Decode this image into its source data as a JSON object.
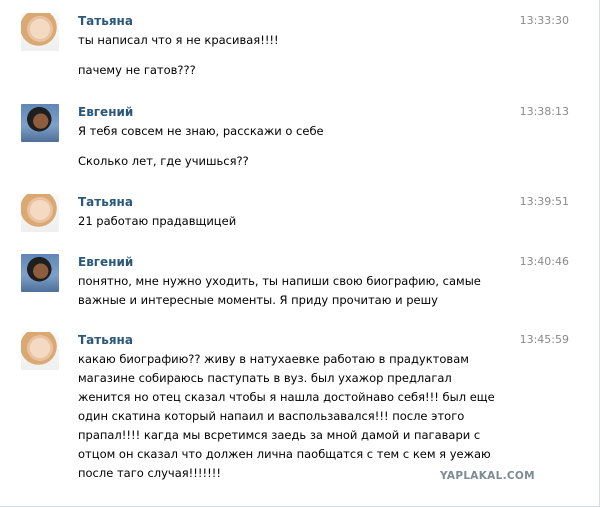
{
  "messages": [
    {
      "author": "Татьяна",
      "time": "13:33:30",
      "lines": [
        "ты написал что я не красивая!!!!"
      ],
      "lines2": [
        "пачему не гатов???"
      ]
    },
    {
      "author": "Евгений",
      "time": "13:38:13",
      "lines": [
        "Я тебя совсем не знаю, расскажи о себе"
      ],
      "lines2": [
        "Сколько лет, где учишься??"
      ]
    },
    {
      "author": "Татьяна",
      "time": "13:39:51",
      "lines": [
        "21 работаю прадавщицей"
      ]
    },
    {
      "author": "Евгений",
      "time": "13:40:46",
      "lines": [
        "понятно, мне нужно уходить, ты напиши свою биографию, самые",
        "важные и интересные моменты. Я приду прочитаю и решу"
      ]
    },
    {
      "author": "Татьяна",
      "time": "13:45:59",
      "lines": [
        "какаю биографию?? живу в натухаевке работаю в прадуктовам",
        "магазине собираюсь паступать в вуз. был ухажор предлагал",
        "женится но отец сказал чтобы я нашла достойнаво себя!!! был еще",
        "один скатина который напаил и васпользавался!!! после этого",
        "прапал!!!! кагда мы всретимся заедь за мной дамой и пагавари с",
        "отцом он сказал что должен лична паобщатся с тем с кем я уежаю",
        "после таго случая!!!!!!!"
      ]
    }
  ],
  "watermark": "YAPLAKAL.COM"
}
